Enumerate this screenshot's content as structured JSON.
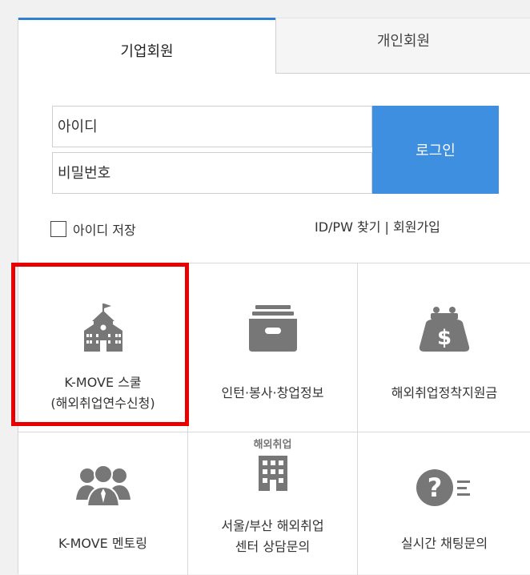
{
  "tabs": {
    "corporate": "기업회원",
    "personal": "개인회원"
  },
  "login": {
    "id_placeholder": "아이디",
    "pw_placeholder": "비밀번호",
    "button": "로그인",
    "save_id": "아이디 저장",
    "find": "ID/PW 찾기",
    "separator": "|",
    "signup": "회원가입"
  },
  "menu": {
    "kmove_school_line1": "K-MOVE 스쿨",
    "kmove_school_line2": "(해외취업연수신청)",
    "intern": "인턴·봉사·창업정보",
    "subsidy": "해외취업정착지원금",
    "mentoring": "K-MOVE 멘토링",
    "center_line1": "서울/부산 해외취업",
    "center_line2": "센터 상담문의",
    "center_icon_text": "해외취업",
    "chat": "실시간 채팅문의"
  },
  "colors": {
    "accent": "#2f7fd5",
    "button": "#3f8fe0",
    "highlight": "#e80000",
    "icon": "#777777"
  }
}
